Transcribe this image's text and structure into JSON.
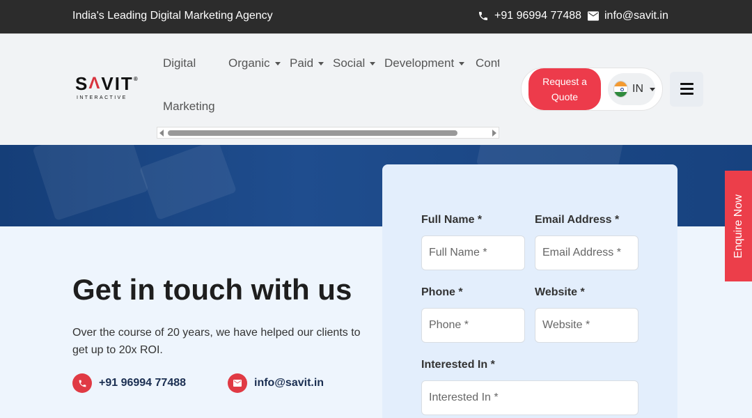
{
  "topbar": {
    "tagline": "India's Leading Digital Marketing Agency",
    "phone": "+91 96994 77488",
    "email": "info@savit.in"
  },
  "logo": {
    "word_left": "S",
    "word_mark": "Λ",
    "word_right": "VIT",
    "reg": "®",
    "sub": "INTERACTIVE"
  },
  "nav": {
    "items": [
      {
        "label_line1": "Digital",
        "label_line2": "Marketing"
      },
      {
        "label": "Organic"
      },
      {
        "label": "Paid"
      },
      {
        "label": "Social"
      },
      {
        "label": "Development"
      },
      {
        "label": "Cont"
      }
    ]
  },
  "cta": {
    "quote_line1": "Request a",
    "quote_line2": "Quote",
    "lang_code": "IN"
  },
  "hero": {
    "title": "Get in touch with us",
    "description": "Over the course of 20 years, we have helped our clients to get up to 20x ROI.",
    "phone": "+91 96994 77488",
    "email": "info@savit.in"
  },
  "form": {
    "full_name_label": "Full Name *",
    "full_name_placeholder": "Full Name *",
    "email_label": "Email Address *",
    "email_placeholder": "Email Address *",
    "phone_label": "Phone *",
    "phone_placeholder": "Phone *",
    "website_label": "Website *",
    "website_placeholder": "Website *",
    "interest_label": "Interested In *",
    "interest_placeholder": "Interested In *"
  },
  "enquire_tab": "Enquire Now",
  "colors": {
    "accent": "#ec3e4a",
    "topbar": "#2c2c2c",
    "hero_blue": "#1b4785",
    "form_bg": "#e3eefc"
  }
}
